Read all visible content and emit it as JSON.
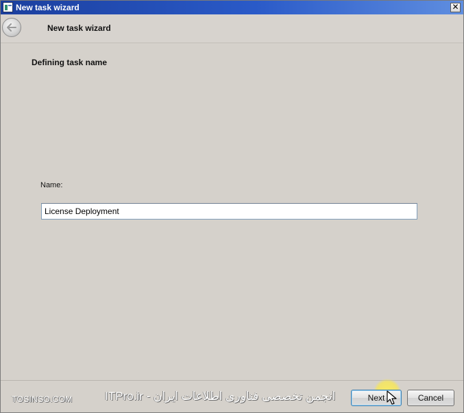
{
  "window": {
    "title": "New task wizard",
    "close_glyph": "✕"
  },
  "header": {
    "title": "New task wizard",
    "back_icon": "back-arrow-icon"
  },
  "content": {
    "section_heading": "Defining task name",
    "name_label": "Name:",
    "name_value": "License Deployment"
  },
  "footer": {
    "next_label": "Next",
    "cancel_label": "Cancel"
  },
  "watermark": {
    "left_text": "TOSINSO.COM",
    "center_text": "ITPro.ir - انجمن تخصصی فناوری اطلاعات ایران"
  },
  "colors": {
    "titlebar_start": "#1b3f9e",
    "titlebar_end": "#5f8ee0",
    "window_bg": "#d5d1cb",
    "input_border": "#7f9db9",
    "focus_button_border": "#3c7fb1",
    "cursor_highlight": "#ffeb3c"
  }
}
